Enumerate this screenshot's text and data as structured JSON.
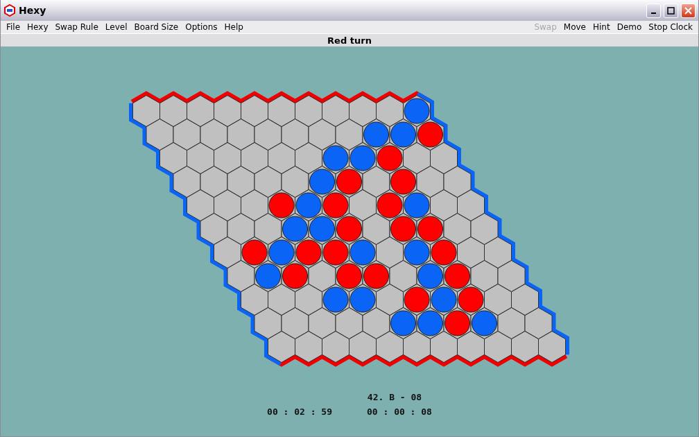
{
  "window": {
    "title": "Hexy"
  },
  "menu_left": [
    {
      "label": "File",
      "disabled": false
    },
    {
      "label": "Hexy",
      "disabled": false
    },
    {
      "label": "Swap Rule",
      "disabled": false
    },
    {
      "label": "Level",
      "disabled": false
    },
    {
      "label": "Board Size",
      "disabled": false
    },
    {
      "label": "Options",
      "disabled": false
    },
    {
      "label": "Help",
      "disabled": false
    }
  ],
  "menu_right": [
    {
      "label": "Swap",
      "disabled": true
    },
    {
      "label": "Move",
      "disabled": false
    },
    {
      "label": "Hint",
      "disabled": false
    },
    {
      "label": "Demo",
      "disabled": false
    },
    {
      "label": "Stop Clock",
      "disabled": false
    }
  ],
  "status": "Red turn",
  "board": {
    "rows": [
      {
        "cells": [
          {
            "kind": "empty"
          },
          {
            "kind": "empty"
          },
          {
            "kind": "empty"
          },
          {
            "kind": "empty"
          },
          {
            "kind": "empty"
          },
          {
            "kind": "empty"
          },
          {
            "kind": "empty"
          },
          {
            "kind": "empty"
          },
          {
            "kind": "empty"
          },
          {
            "kind": "empty"
          },
          {
            "kind": "blue"
          }
        ]
      },
      {
        "cells": [
          {
            "kind": "empty"
          },
          {
            "kind": "empty"
          },
          {
            "kind": "empty"
          },
          {
            "kind": "empty"
          },
          {
            "kind": "empty"
          },
          {
            "kind": "empty"
          },
          {
            "kind": "empty"
          },
          {
            "kind": "empty"
          },
          {
            "kind": "blue"
          },
          {
            "kind": "blue"
          },
          {
            "kind": "red"
          }
        ]
      },
      {
        "cells": [
          {
            "kind": "empty"
          },
          {
            "kind": "empty"
          },
          {
            "kind": "empty"
          },
          {
            "kind": "empty"
          },
          {
            "kind": "empty"
          },
          {
            "kind": "empty"
          },
          {
            "kind": "blue"
          },
          {
            "kind": "blue"
          },
          {
            "kind": "red"
          },
          {
            "kind": "empty"
          },
          {
            "kind": "empty"
          }
        ]
      },
      {
        "cells": [
          {
            "kind": "empty"
          },
          {
            "kind": "empty"
          },
          {
            "kind": "empty"
          },
          {
            "kind": "empty"
          },
          {
            "kind": "empty"
          },
          {
            "kind": "blue"
          },
          {
            "kind": "red"
          },
          {
            "kind": "empty"
          },
          {
            "kind": "red"
          },
          {
            "kind": "empty"
          },
          {
            "kind": "empty"
          }
        ]
      },
      {
        "cells": [
          {
            "kind": "empty"
          },
          {
            "kind": "empty"
          },
          {
            "kind": "empty"
          },
          {
            "kind": "red"
          },
          {
            "kind": "blue"
          },
          {
            "kind": "red"
          },
          {
            "kind": "empty"
          },
          {
            "kind": "red"
          },
          {
            "kind": "blue"
          },
          {
            "kind": "empty"
          },
          {
            "kind": "empty"
          }
        ]
      },
      {
        "cells": [
          {
            "kind": "empty"
          },
          {
            "kind": "empty"
          },
          {
            "kind": "empty"
          },
          {
            "kind": "blue"
          },
          {
            "kind": "blue"
          },
          {
            "kind": "red"
          },
          {
            "kind": "empty"
          },
          {
            "kind": "red"
          },
          {
            "kind": "red"
          },
          {
            "kind": "empty"
          },
          {
            "kind": "empty"
          }
        ]
      },
      {
        "cells": [
          {
            "kind": "empty"
          },
          {
            "kind": "red"
          },
          {
            "kind": "blue"
          },
          {
            "kind": "red"
          },
          {
            "kind": "red"
          },
          {
            "kind": "blue"
          },
          {
            "kind": "empty"
          },
          {
            "kind": "blue"
          },
          {
            "kind": "red"
          },
          {
            "kind": "empty"
          },
          {
            "kind": "empty"
          }
        ]
      },
      {
        "cells": [
          {
            "kind": "empty"
          },
          {
            "kind": "blue"
          },
          {
            "kind": "red"
          },
          {
            "kind": "empty"
          },
          {
            "kind": "red"
          },
          {
            "kind": "red"
          },
          {
            "kind": "empty"
          },
          {
            "kind": "blue"
          },
          {
            "kind": "red"
          },
          {
            "kind": "empty"
          },
          {
            "kind": "empty"
          }
        ]
      },
      {
        "cells": [
          {
            "kind": "empty"
          },
          {
            "kind": "empty"
          },
          {
            "kind": "empty"
          },
          {
            "kind": "blue"
          },
          {
            "kind": "blue"
          },
          {
            "kind": "empty"
          },
          {
            "kind": "red"
          },
          {
            "kind": "blue"
          },
          {
            "kind": "red"
          },
          {
            "kind": "empty"
          },
          {
            "kind": "empty"
          }
        ]
      },
      {
        "cells": [
          {
            "kind": "empty"
          },
          {
            "kind": "empty"
          },
          {
            "kind": "empty"
          },
          {
            "kind": "empty"
          },
          {
            "kind": "empty"
          },
          {
            "kind": "blue"
          },
          {
            "kind": "blue"
          },
          {
            "kind": "red"
          },
          {
            "kind": "blue"
          },
          {
            "kind": "empty"
          },
          {
            "kind": "empty"
          }
        ]
      },
      {
        "cells": [
          {
            "kind": "empty"
          },
          {
            "kind": "empty"
          },
          {
            "kind": "empty"
          },
          {
            "kind": "empty"
          },
          {
            "kind": "empty"
          },
          {
            "kind": "empty"
          },
          {
            "kind": "empty"
          },
          {
            "kind": "empty"
          },
          {
            "kind": "empty"
          },
          {
            "kind": "empty"
          },
          {
            "kind": "empty"
          }
        ]
      }
    ]
  },
  "last_move": "42.  B - 08",
  "clocks": [
    "00 : 02 : 59",
    "00 : 00 : 08"
  ]
}
